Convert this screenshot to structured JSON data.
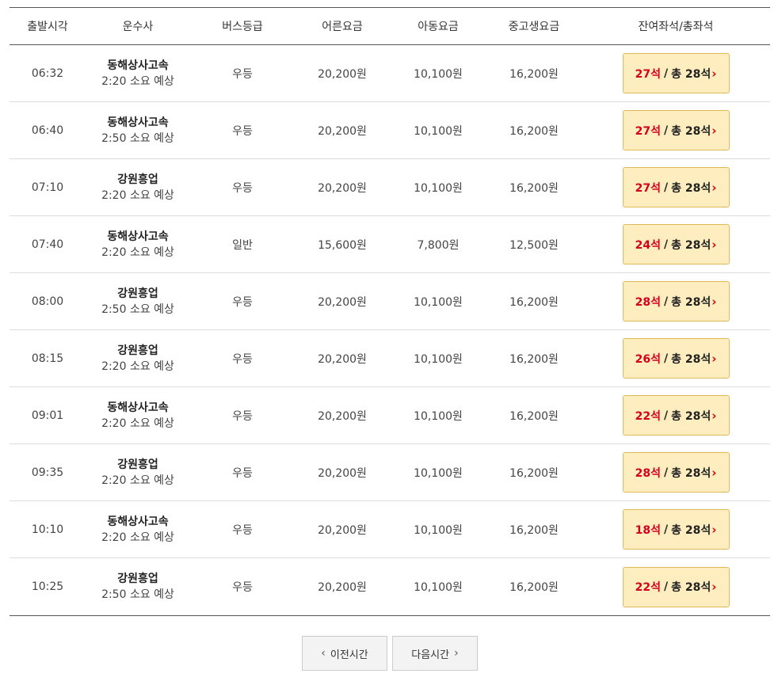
{
  "header": {
    "time": "출발시각",
    "operator": "운수사",
    "grade": "버스등급",
    "adult": "어른요금",
    "child": "아동요금",
    "teen": "중고생요금",
    "seats": "잔여좌석/총좌석"
  },
  "rows": [
    {
      "time": "06:32",
      "operator": "동해상사고속",
      "duration": "2:20 소요 예상",
      "grade": "우등",
      "adult": "20,200원",
      "child": "10,100원",
      "teen": "16,200원",
      "remain": "27석",
      "total": "총 28석"
    },
    {
      "time": "06:40",
      "operator": "동해상사고속",
      "duration": "2:50 소요 예상",
      "grade": "우등",
      "adult": "20,200원",
      "child": "10,100원",
      "teen": "16,200원",
      "remain": "27석",
      "total": "총 28석"
    },
    {
      "time": "07:10",
      "operator": "강원흥업",
      "duration": "2:20 소요 예상",
      "grade": "우등",
      "adult": "20,200원",
      "child": "10,100원",
      "teen": "16,200원",
      "remain": "27석",
      "total": "총 28석"
    },
    {
      "time": "07:40",
      "operator": "동해상사고속",
      "duration": "2:20 소요 예상",
      "grade": "일반",
      "adult": "15,600원",
      "child": "7,800원",
      "teen": "12,500원",
      "remain": "24석",
      "total": "총 28석"
    },
    {
      "time": "08:00",
      "operator": "강원흥업",
      "duration": "2:50 소요 예상",
      "grade": "우등",
      "adult": "20,200원",
      "child": "10,100원",
      "teen": "16,200원",
      "remain": "28석",
      "total": "총 28석"
    },
    {
      "time": "08:15",
      "operator": "강원흥업",
      "duration": "2:20 소요 예상",
      "grade": "우등",
      "adult": "20,200원",
      "child": "10,100원",
      "teen": "16,200원",
      "remain": "26석",
      "total": "총 28석"
    },
    {
      "time": "09:01",
      "operator": "동해상사고속",
      "duration": "2:20 소요 예상",
      "grade": "우등",
      "adult": "20,200원",
      "child": "10,100원",
      "teen": "16,200원",
      "remain": "22석",
      "total": "총 28석"
    },
    {
      "time": "09:35",
      "operator": "강원흥업",
      "duration": "2:20 소요 예상",
      "grade": "우등",
      "adult": "20,200원",
      "child": "10,100원",
      "teen": "16,200원",
      "remain": "28석",
      "total": "총 28석"
    },
    {
      "time": "10:10",
      "operator": "동해상사고속",
      "duration": "2:20 소요 예상",
      "grade": "우등",
      "adult": "20,200원",
      "child": "10,100원",
      "teen": "16,200원",
      "remain": "18석",
      "total": "총 28석"
    },
    {
      "time": "10:25",
      "operator": "강원흥업",
      "duration": "2:50 소요 예상",
      "grade": "우등",
      "adult": "20,200원",
      "child": "10,100원",
      "teen": "16,200원",
      "remain": "22석",
      "total": "총 28석"
    }
  ],
  "seat_separator": "/",
  "pager": {
    "prev_label": "이전시간",
    "next_label": "다음시간",
    "prev_icon": "chevron-left-icon",
    "next_icon": "chevron-right-icon"
  },
  "colors": {
    "remain": "#d6001c",
    "seat_button_bg": "#fdedbf",
    "seat_button_border": "#e0b95a"
  }
}
